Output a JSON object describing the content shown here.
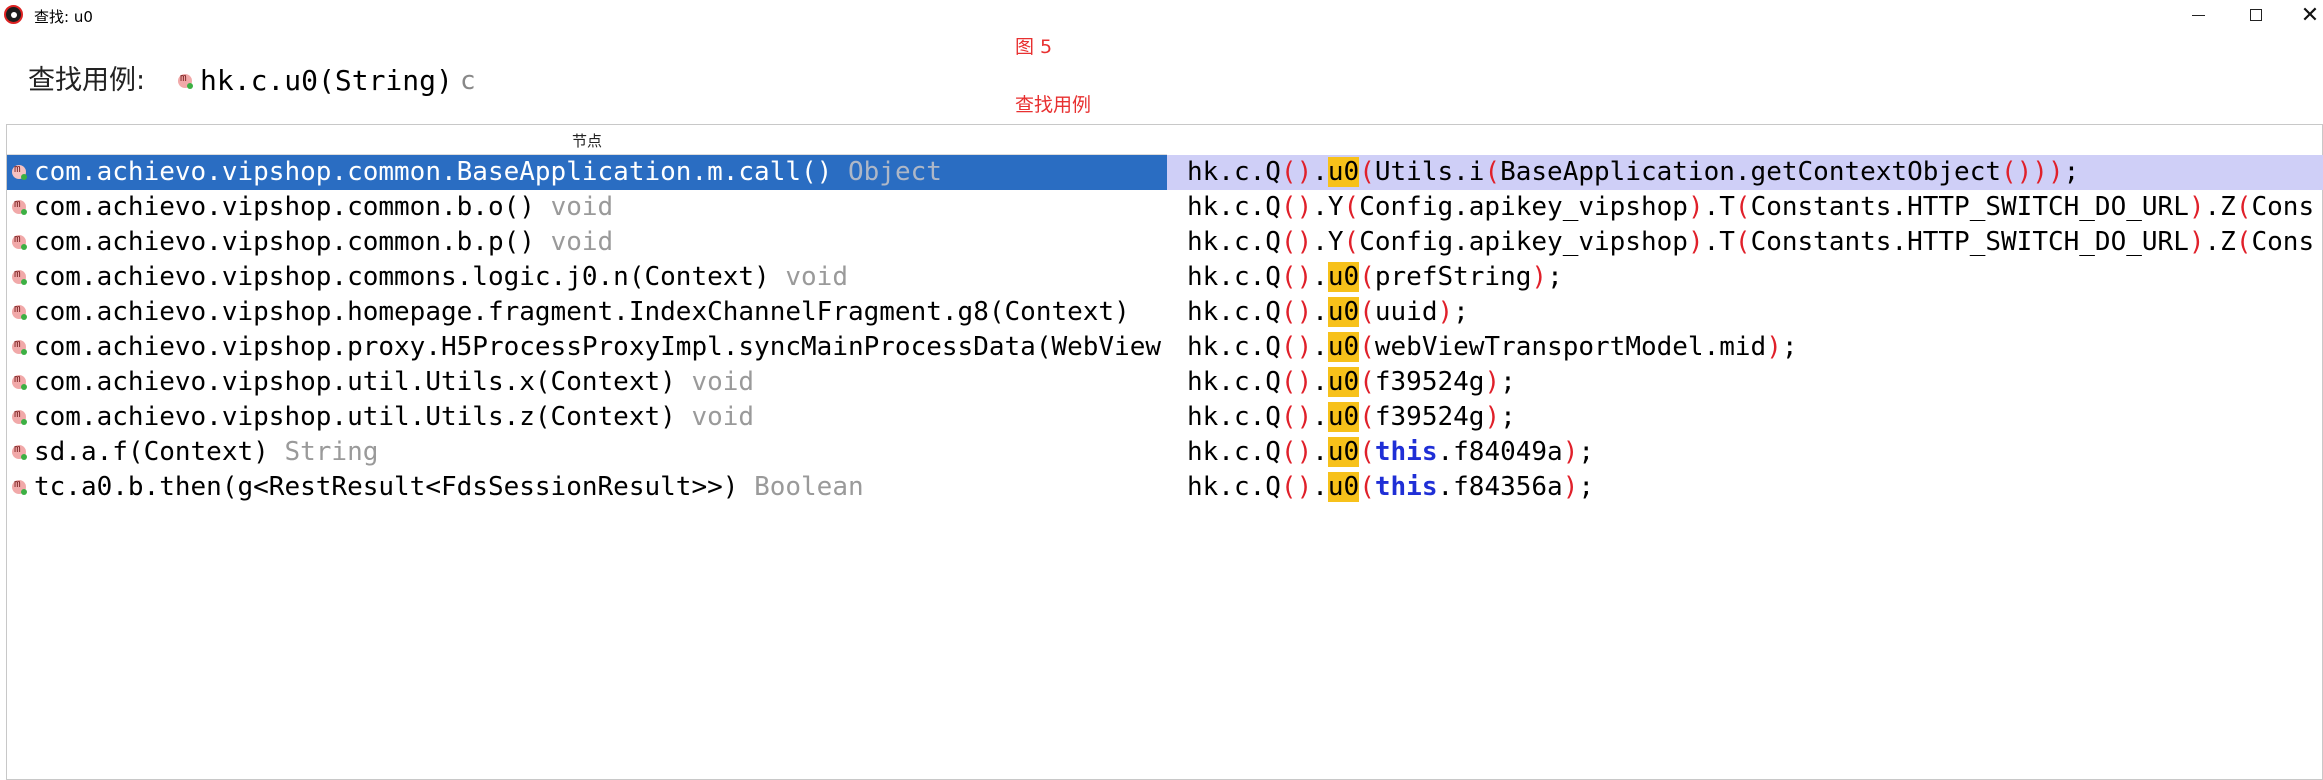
{
  "window": {
    "title": "查找: u0"
  },
  "annotations": {
    "figure": "图 5",
    "caption": "查找用例"
  },
  "header": {
    "label": "查找用例:",
    "method": "hk.c.u0(String)",
    "kind": "c"
  },
  "table": {
    "column_header": "节点",
    "rows": [
      {
        "sig": "com.achievo.vipshop.common.BaseApplication.m.call()",
        "ret": "Object",
        "code": {
          "pre": "hk.c.Q",
          "p1": "()",
          "dot": ".",
          "m": "u0",
          "p2": "(",
          "a": "Utils.i",
          "p3": "(",
          "b": "BaseApplication.getContextObject",
          "p4": "()))",
          "c": ";"
        }
      },
      {
        "sig": "com.achievo.vipshop.common.b.o()",
        "ret": "void",
        "code": {
          "pre": "hk.c.Q",
          "p1": "()",
          "dot": ".",
          "m": "Y",
          "p2": "(",
          "a": "Config.apikey_vipshop",
          "p3": ")",
          "b": ".T",
          "p4": "(",
          "c": "Constants.HTTP_SWITCH_DO_URL",
          "p5": ")",
          "d": ".Z",
          "p6": "(",
          "e": "Cons"
        }
      },
      {
        "sig": "com.achievo.vipshop.common.b.p()",
        "ret": "void",
        "code": {
          "pre": "hk.c.Q",
          "p1": "()",
          "dot": ".",
          "m": "Y",
          "p2": "(",
          "a": "Config.apikey_vipshop",
          "p3": ")",
          "b": ".T",
          "p4": "(",
          "c": "Constants.HTTP_SWITCH_DO_URL",
          "p5": ")",
          "d": ".Z",
          "p6": "(",
          "e": "Cons"
        }
      },
      {
        "sig": "com.achievo.vipshop.commons.logic.j0.n(Context)",
        "ret": "void",
        "code": {
          "pre": "hk.c.Q",
          "p1": "()",
          "dot": ".",
          "m": "u0",
          "p2": "(",
          "a": "prefString",
          "p3": ")",
          "c": ";"
        }
      },
      {
        "sig": "com.achievo.vipshop.homepage.fragment.IndexChannelFragment.g8(Context)",
        "ret": "",
        "code": {
          "pre": "hk.c.Q",
          "p1": "()",
          "dot": ".",
          "m": "u0",
          "p2": "(",
          "a": "uuid",
          "p3": ")",
          "c": ";"
        }
      },
      {
        "sig": "com.achievo.vipshop.proxy.H5ProcessProxyImpl.syncMainProcessData(WebView",
        "ret": "",
        "code": {
          "pre": "hk.c.Q",
          "p1": "()",
          "dot": ".",
          "m": "u0",
          "p2": "(",
          "a": "webViewTransportModel.mid",
          "p3": ")",
          "c": ";"
        }
      },
      {
        "sig": "com.achievo.vipshop.util.Utils.x(Context)",
        "ret": "void",
        "code": {
          "pre": "hk.c.Q",
          "p1": "()",
          "dot": ".",
          "m": "u0",
          "p2": "(",
          "a": "f39524g",
          "p3": ")",
          "c": ";"
        }
      },
      {
        "sig": "com.achievo.vipshop.util.Utils.z(Context)",
        "ret": "void",
        "code": {
          "pre": "hk.c.Q",
          "p1": "()",
          "dot": ".",
          "m": "u0",
          "p2": "(",
          "a": "f39524g",
          "p3": ")",
          "c": ";"
        }
      },
      {
        "sig": "sd.a.f(Context)",
        "ret": "String",
        "code": {
          "pre": "hk.c.Q",
          "p1": "()",
          "dot": ".",
          "m": "u0",
          "p2": "(",
          "kw": "this",
          "a": ".f84049a",
          "p3": ")",
          "c": ";"
        }
      },
      {
        "sig": "tc.a0.b.then(g<RestResult<FdsSessionResult>>)",
        "ret": "Boolean",
        "code": {
          "pre": "hk.c.Q",
          "p1": "()",
          "dot": ".",
          "m": "u0",
          "p2": "(",
          "kw": "this",
          "a": ".f84356a",
          "p3": ")",
          "c": ";"
        }
      }
    ]
  }
}
